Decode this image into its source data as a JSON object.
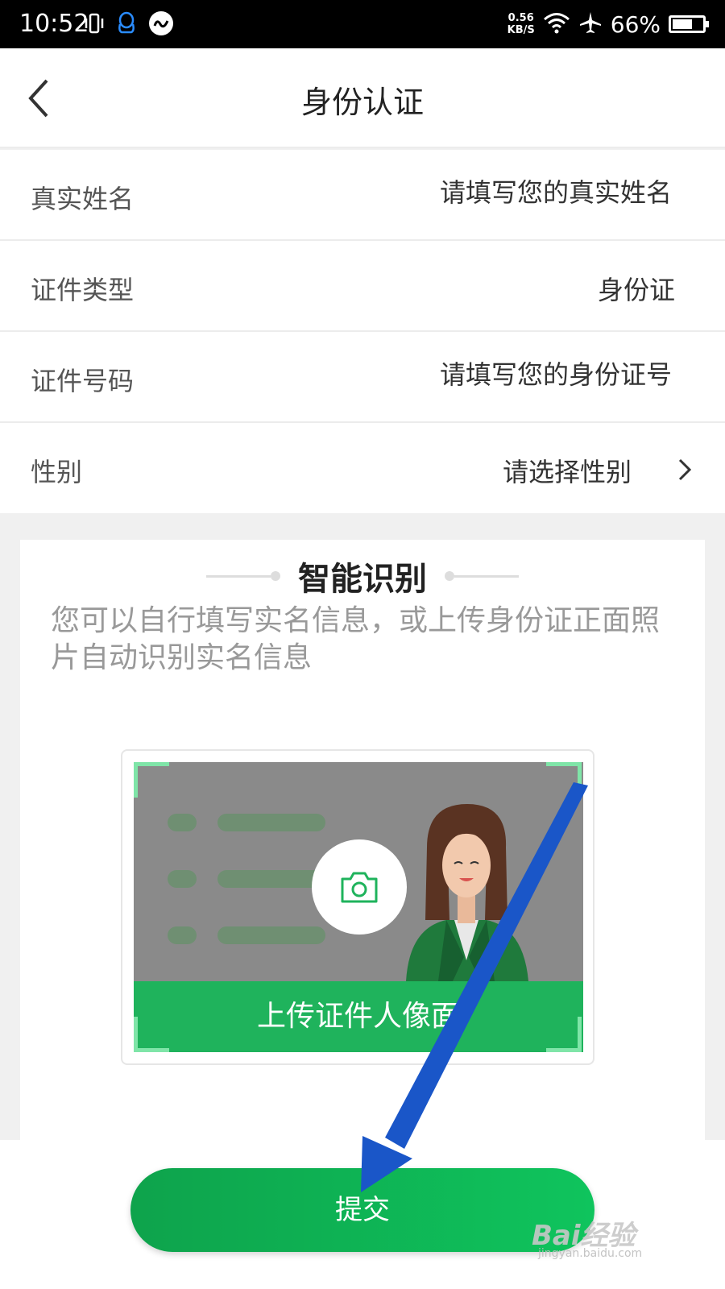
{
  "status_bar": {
    "time": "10:52",
    "speed": "0.56",
    "speed_unit": "KB/S",
    "battery": "66%",
    "battery_level": 0.66
  },
  "header": {
    "title": "身份认证"
  },
  "form": {
    "name": {
      "label": "真实姓名",
      "placeholder": "请填写您的真实姓名"
    },
    "id_type": {
      "label": "证件类型",
      "value": "身份证"
    },
    "id_number": {
      "label": "证件号码",
      "placeholder": "请填写您的身份证号"
    },
    "gender": {
      "label": "性别",
      "value": "请选择性别"
    }
  },
  "smart_recognition": {
    "title": "智能识别",
    "description": "您可以自行填写实名信息，或上传身份证正面照片自动识别实名信息",
    "upload_label": "上传证件人像面"
  },
  "submit": {
    "label": "提交"
  },
  "watermark": {
    "brand": "Bai经验",
    "url": "jingyan.baidu.com"
  },
  "colors": {
    "accent": "#0fb356",
    "annotation_arrow": "#1a56c8"
  }
}
